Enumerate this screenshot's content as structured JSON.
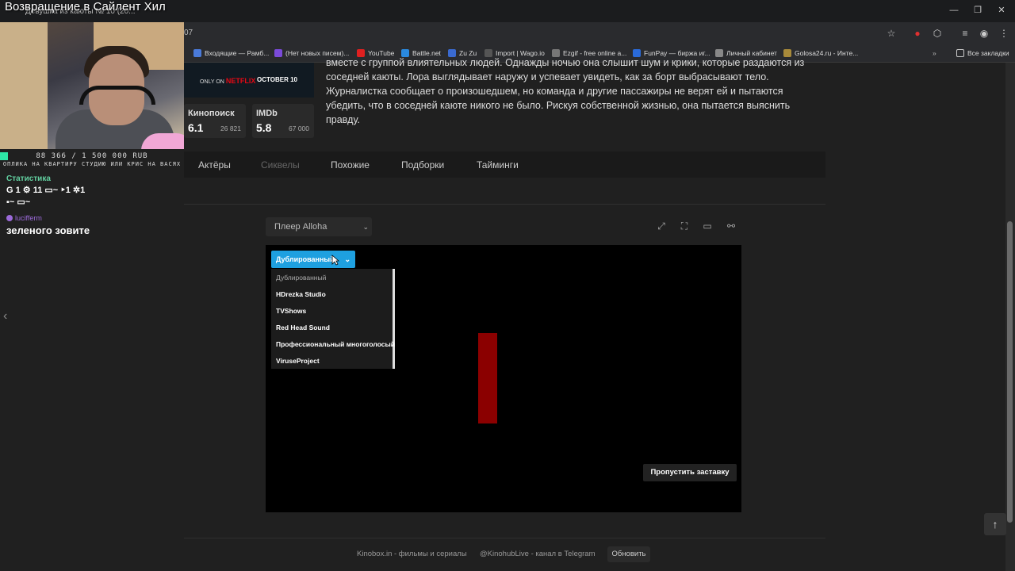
{
  "stream": {
    "title": "Возвращение в Сайлент Хил",
    "goal": "88 366 / 1 500 000 RUB",
    "goal_sub": "ОПЛИКА НА КВАРТИРУ СТУДИЮ ИЛИ КРИС НА ВАСЯХ",
    "stats_title": "Статистика",
    "stats_line1": "G 1  ⚙ 11  ▭~  ‣1  ✲1",
    "stats_line2": "▪~  ▭~",
    "chat_user": "lucifferm",
    "chat_message": "зеленого зовите"
  },
  "browser": {
    "tab_title": "Девушка из каюты № 10 (20...",
    "address_fragment": "07",
    "bookmarks": [
      "Входящие — Рамб...",
      "(Нет новых писем)...",
      "YouTube",
      "Battle.net",
      "Zu Zu",
      "Import | Wago.io",
      "Ezgif - free online a...",
      "FunPay — биржа иг...",
      "Личный кабинет",
      "Golosa24.ru - Инте..."
    ],
    "all_bookmarks": "Все закладки"
  },
  "poster": {
    "network_prefix": "ONLY ON",
    "network": "NETFLIX",
    "date": "OCTOBER 10"
  },
  "ratings": [
    {
      "name": "Кинопоиск",
      "value": "6.1",
      "count": "26 821"
    },
    {
      "name": "IMDb",
      "value": "5.8",
      "count": "67 000"
    }
  ],
  "description": "вместе с группой влиятельных людей. Однажды ночью она слышит шум и крики, которые раздаются из соседней каюты. Лора выглядывает наружу и успевает увидеть, как за борт выбрасывают тело. Журналистка сообщает о произошедшем, но команда и другие пассажиры не верят ей и пытаются убедить, что в соседней каюте никого не было. Рискуя собственной жизнью, она пытается выяснить правду.",
  "tabs": [
    "Актёры",
    "Сиквелы",
    "Похожие",
    "Подборки",
    "Тайминги"
  ],
  "player": {
    "selector": "Плеер Alloha",
    "dub_selected": "Дублированный",
    "dub_options": [
      "Дублированный",
      "HDrezka Studio",
      "TVShows",
      "Red Head Sound",
      "Профессиональный многоголосый",
      "ViruseProject"
    ],
    "skip_label": "Пропустить заставку"
  },
  "footer": {
    "site": "Kinobox.in - фильмы и сериалы",
    "telegram": "@KinohubLive - канал в Telegram",
    "refresh": "Обновить"
  },
  "colors": {
    "accent": "#1ea0e0",
    "background": "#202020",
    "video_bar": "#8b0000"
  }
}
